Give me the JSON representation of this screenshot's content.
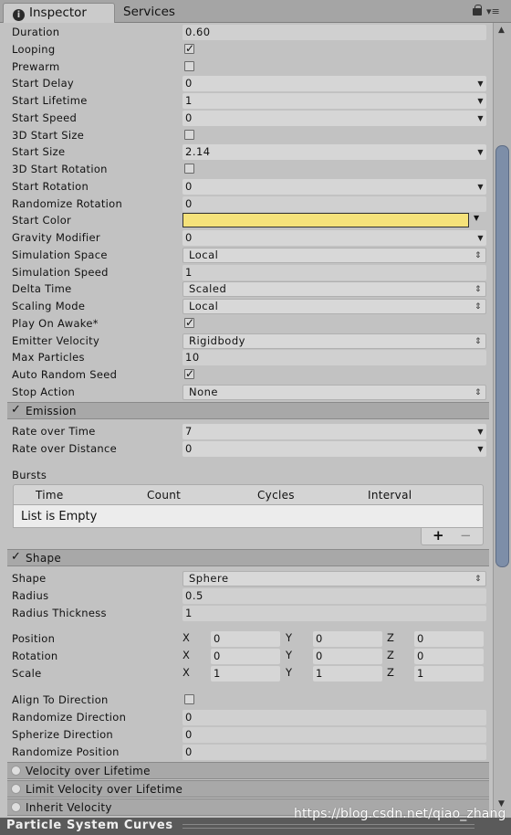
{
  "tabs": {
    "inspector": "Inspector",
    "services": "Services"
  },
  "main": [
    {
      "label": "Duration",
      "type": "text",
      "value": "0.60"
    },
    {
      "label": "Looping",
      "type": "check",
      "checked": true
    },
    {
      "label": "Prewarm",
      "type": "check",
      "checked": false
    },
    {
      "label": "Start Delay",
      "type": "dd",
      "value": "0"
    },
    {
      "label": "Start Lifetime",
      "type": "dd",
      "value": "1"
    },
    {
      "label": "Start Speed",
      "type": "dd",
      "value": "0"
    },
    {
      "label": "3D Start Size",
      "type": "check",
      "checked": false
    },
    {
      "label": "Start Size",
      "type": "dd",
      "value": "2.14"
    },
    {
      "label": "3D Start Rotation",
      "type": "check",
      "checked": false
    },
    {
      "label": "Start Rotation",
      "type": "dd",
      "value": "0"
    },
    {
      "label": "Randomize Rotation",
      "type": "text",
      "value": "0"
    },
    {
      "label": "Start Color",
      "type": "color",
      "value": "#f5e27a"
    },
    {
      "label": "Gravity Modifier",
      "type": "dd",
      "value": "0"
    },
    {
      "label": "Simulation Space",
      "type": "popup",
      "value": "Local"
    },
    {
      "label": "Simulation Speed",
      "type": "text",
      "value": "1"
    },
    {
      "label": "Delta Time",
      "type": "popup",
      "value": "Scaled"
    },
    {
      "label": "Scaling Mode",
      "type": "popup",
      "value": "Local"
    },
    {
      "label": "Play On Awake*",
      "type": "check",
      "checked": true
    },
    {
      "label": "Emitter Velocity",
      "type": "popup",
      "value": "Rigidbody"
    },
    {
      "label": "Max Particles",
      "type": "text",
      "value": "10"
    },
    {
      "label": "Auto Random Seed",
      "type": "check",
      "checked": true
    },
    {
      "label": "Stop Action",
      "type": "popup",
      "value": "None"
    }
  ],
  "emission": {
    "title": "Emission",
    "rate_over_time": {
      "label": "Rate over Time",
      "value": "7"
    },
    "rate_over_distance": {
      "label": "Rate over Distance",
      "value": "0"
    },
    "bursts_label": "Bursts",
    "columns": [
      "Time",
      "Count",
      "Cycles",
      "Interval"
    ],
    "empty_text": "List is Empty",
    "add": "+",
    "remove": "−"
  },
  "shape": {
    "title": "Shape",
    "shape": {
      "label": "Shape",
      "value": "Sphere"
    },
    "radius": {
      "label": "Radius",
      "value": "0.5"
    },
    "radius_thickness": {
      "label": "Radius Thickness",
      "value": "1"
    },
    "position": {
      "label": "Position",
      "x": "0",
      "y": "0",
      "z": "0"
    },
    "rotation": {
      "label": "Rotation",
      "x": "0",
      "y": "0",
      "z": "0"
    },
    "scale": {
      "label": "Scale",
      "x": "1",
      "y": "1",
      "z": "1"
    },
    "axis": {
      "x": "X",
      "y": "Y",
      "z": "Z"
    },
    "align_to_direction": {
      "label": "Align To Direction",
      "checked": false
    },
    "randomize_direction": {
      "label": "Randomize Direction",
      "value": "0"
    },
    "spherize_direction": {
      "label": "Spherize Direction",
      "value": "0"
    },
    "randomize_position": {
      "label": "Randomize Position",
      "value": "0"
    }
  },
  "modules": [
    "Velocity over Lifetime",
    "Limit Velocity over Lifetime",
    "Inherit Velocity"
  ],
  "bottom_title": "Particle System Curves",
  "watermark": "https://blog.csdn.net/qiao_zhang",
  "colors": {
    "start_color": "#f5e27a",
    "scroll_thumb": "#7d8ea8"
  },
  "glyphs": {
    "check": "✓",
    "dropdown": "▾",
    "updown": "⇕"
  }
}
